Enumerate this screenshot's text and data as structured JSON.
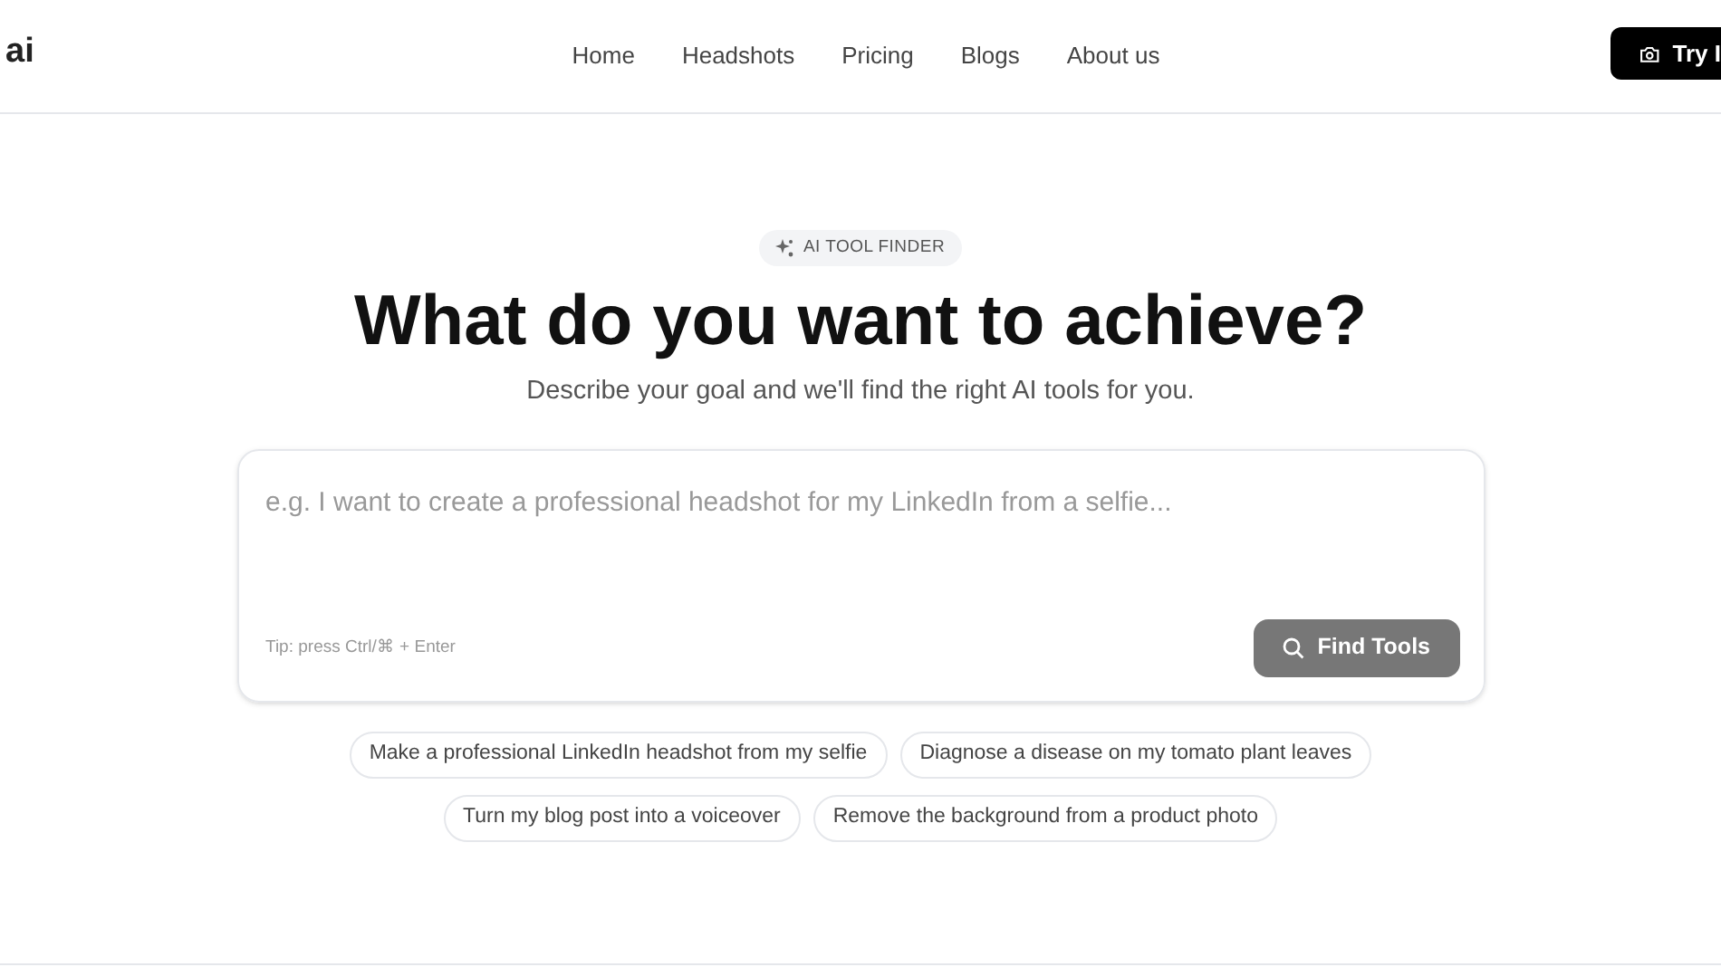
{
  "logo": {
    "text": "ai"
  },
  "nav": [
    {
      "label": "Home"
    },
    {
      "label": "Headshots"
    },
    {
      "label": "Pricing"
    },
    {
      "label": "Blogs"
    },
    {
      "label": "About us"
    }
  ],
  "cta_button": {
    "label": "Try I"
  },
  "badge": {
    "label": "AI TOOL FINDER"
  },
  "heading": "What do you want to achieve?",
  "subheading": "Describe your goal and we'll find the right AI tools for you.",
  "goal_input": {
    "placeholder": "e.g. I want to create a professional headshot for my LinkedIn from a selfie..."
  },
  "tip": "Tip: press Ctrl/⌘ + Enter",
  "find_button": {
    "label": "Find Tools",
    "disabled": true
  },
  "suggestions": [
    [
      "Make a professional LinkedIn headshot from my selfie",
      "Diagnose a disease on my tomato plant leaves"
    ],
    [
      "Turn my blog post into a voiceover",
      "Remove the background from a product photo"
    ]
  ]
}
